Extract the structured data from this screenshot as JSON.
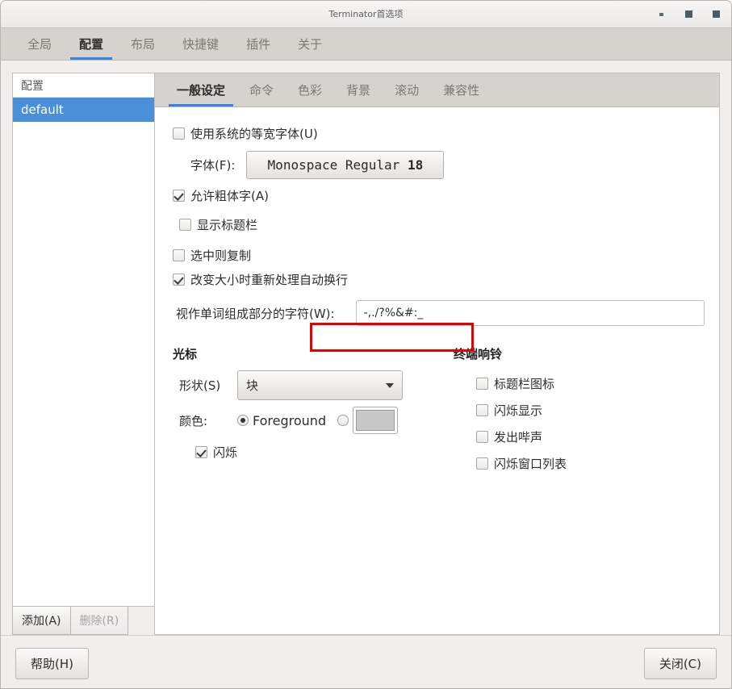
{
  "window": {
    "title": "Terminator首选项",
    "controls": {
      "minimize": "minimize-icon",
      "maximize": "maximize-icon",
      "close": "close-icon"
    }
  },
  "tabs": [
    {
      "label": "全局",
      "active": false
    },
    {
      "label": "配置",
      "active": true
    },
    {
      "label": "布局",
      "active": false
    },
    {
      "label": "快捷键",
      "active": false
    },
    {
      "label": "插件",
      "active": false
    },
    {
      "label": "关于",
      "active": false
    }
  ],
  "sidebar": {
    "header": "配置",
    "items": [
      {
        "label": "default",
        "selected": true
      }
    ],
    "add_label": "添加(A)",
    "delete_label": "删除(R)"
  },
  "subtabs": [
    {
      "label": "一般设定",
      "active": true
    },
    {
      "label": "命令",
      "active": false
    },
    {
      "label": "色彩",
      "active": false
    },
    {
      "label": "背景",
      "active": false
    },
    {
      "label": "滚动",
      "active": false
    },
    {
      "label": "兼容性",
      "active": false
    }
  ],
  "general": {
    "use_system_font": {
      "label": "使用系统的等宽字体(U)",
      "checked": false
    },
    "font_label": "字体(F):",
    "font_name": "Monospace Regular",
    "font_size": "18",
    "allow_bold": {
      "label": "允许粗体字(A)",
      "checked": true
    },
    "show_titlebar": {
      "label": "显示标题栏",
      "checked": false
    },
    "copy_on_selection": {
      "label": "选中则复制",
      "checked": false
    },
    "rewrap_on_resize": {
      "label": "改变大小时重新处理自动换行",
      "checked": true
    },
    "word_chars_label": "视作单词组成部分的字符(W):",
    "word_chars_value": "-,./?%&#:_"
  },
  "cursor": {
    "title": "光标",
    "shape_label": "形状(S)",
    "shape_value": "块",
    "color_label": "颜色:",
    "foreground_label": "Foreground",
    "foreground_selected": true,
    "custom_selected": false,
    "custom_color": "#c8c8c8",
    "blink": {
      "label": "闪烁",
      "checked": true
    }
  },
  "bell": {
    "title": "终端响铃",
    "items": [
      {
        "label": "标题栏图标",
        "checked": false
      },
      {
        "label": "闪烁显示",
        "checked": false
      },
      {
        "label": "发出哔声",
        "checked": false
      },
      {
        "label": "闪烁窗口列表",
        "checked": false
      }
    ]
  },
  "footer": {
    "help_label": "帮助(H)",
    "close_label": "关闭(C)"
  },
  "annotation": {
    "color": "#e60000",
    "target": "显示标题栏"
  }
}
